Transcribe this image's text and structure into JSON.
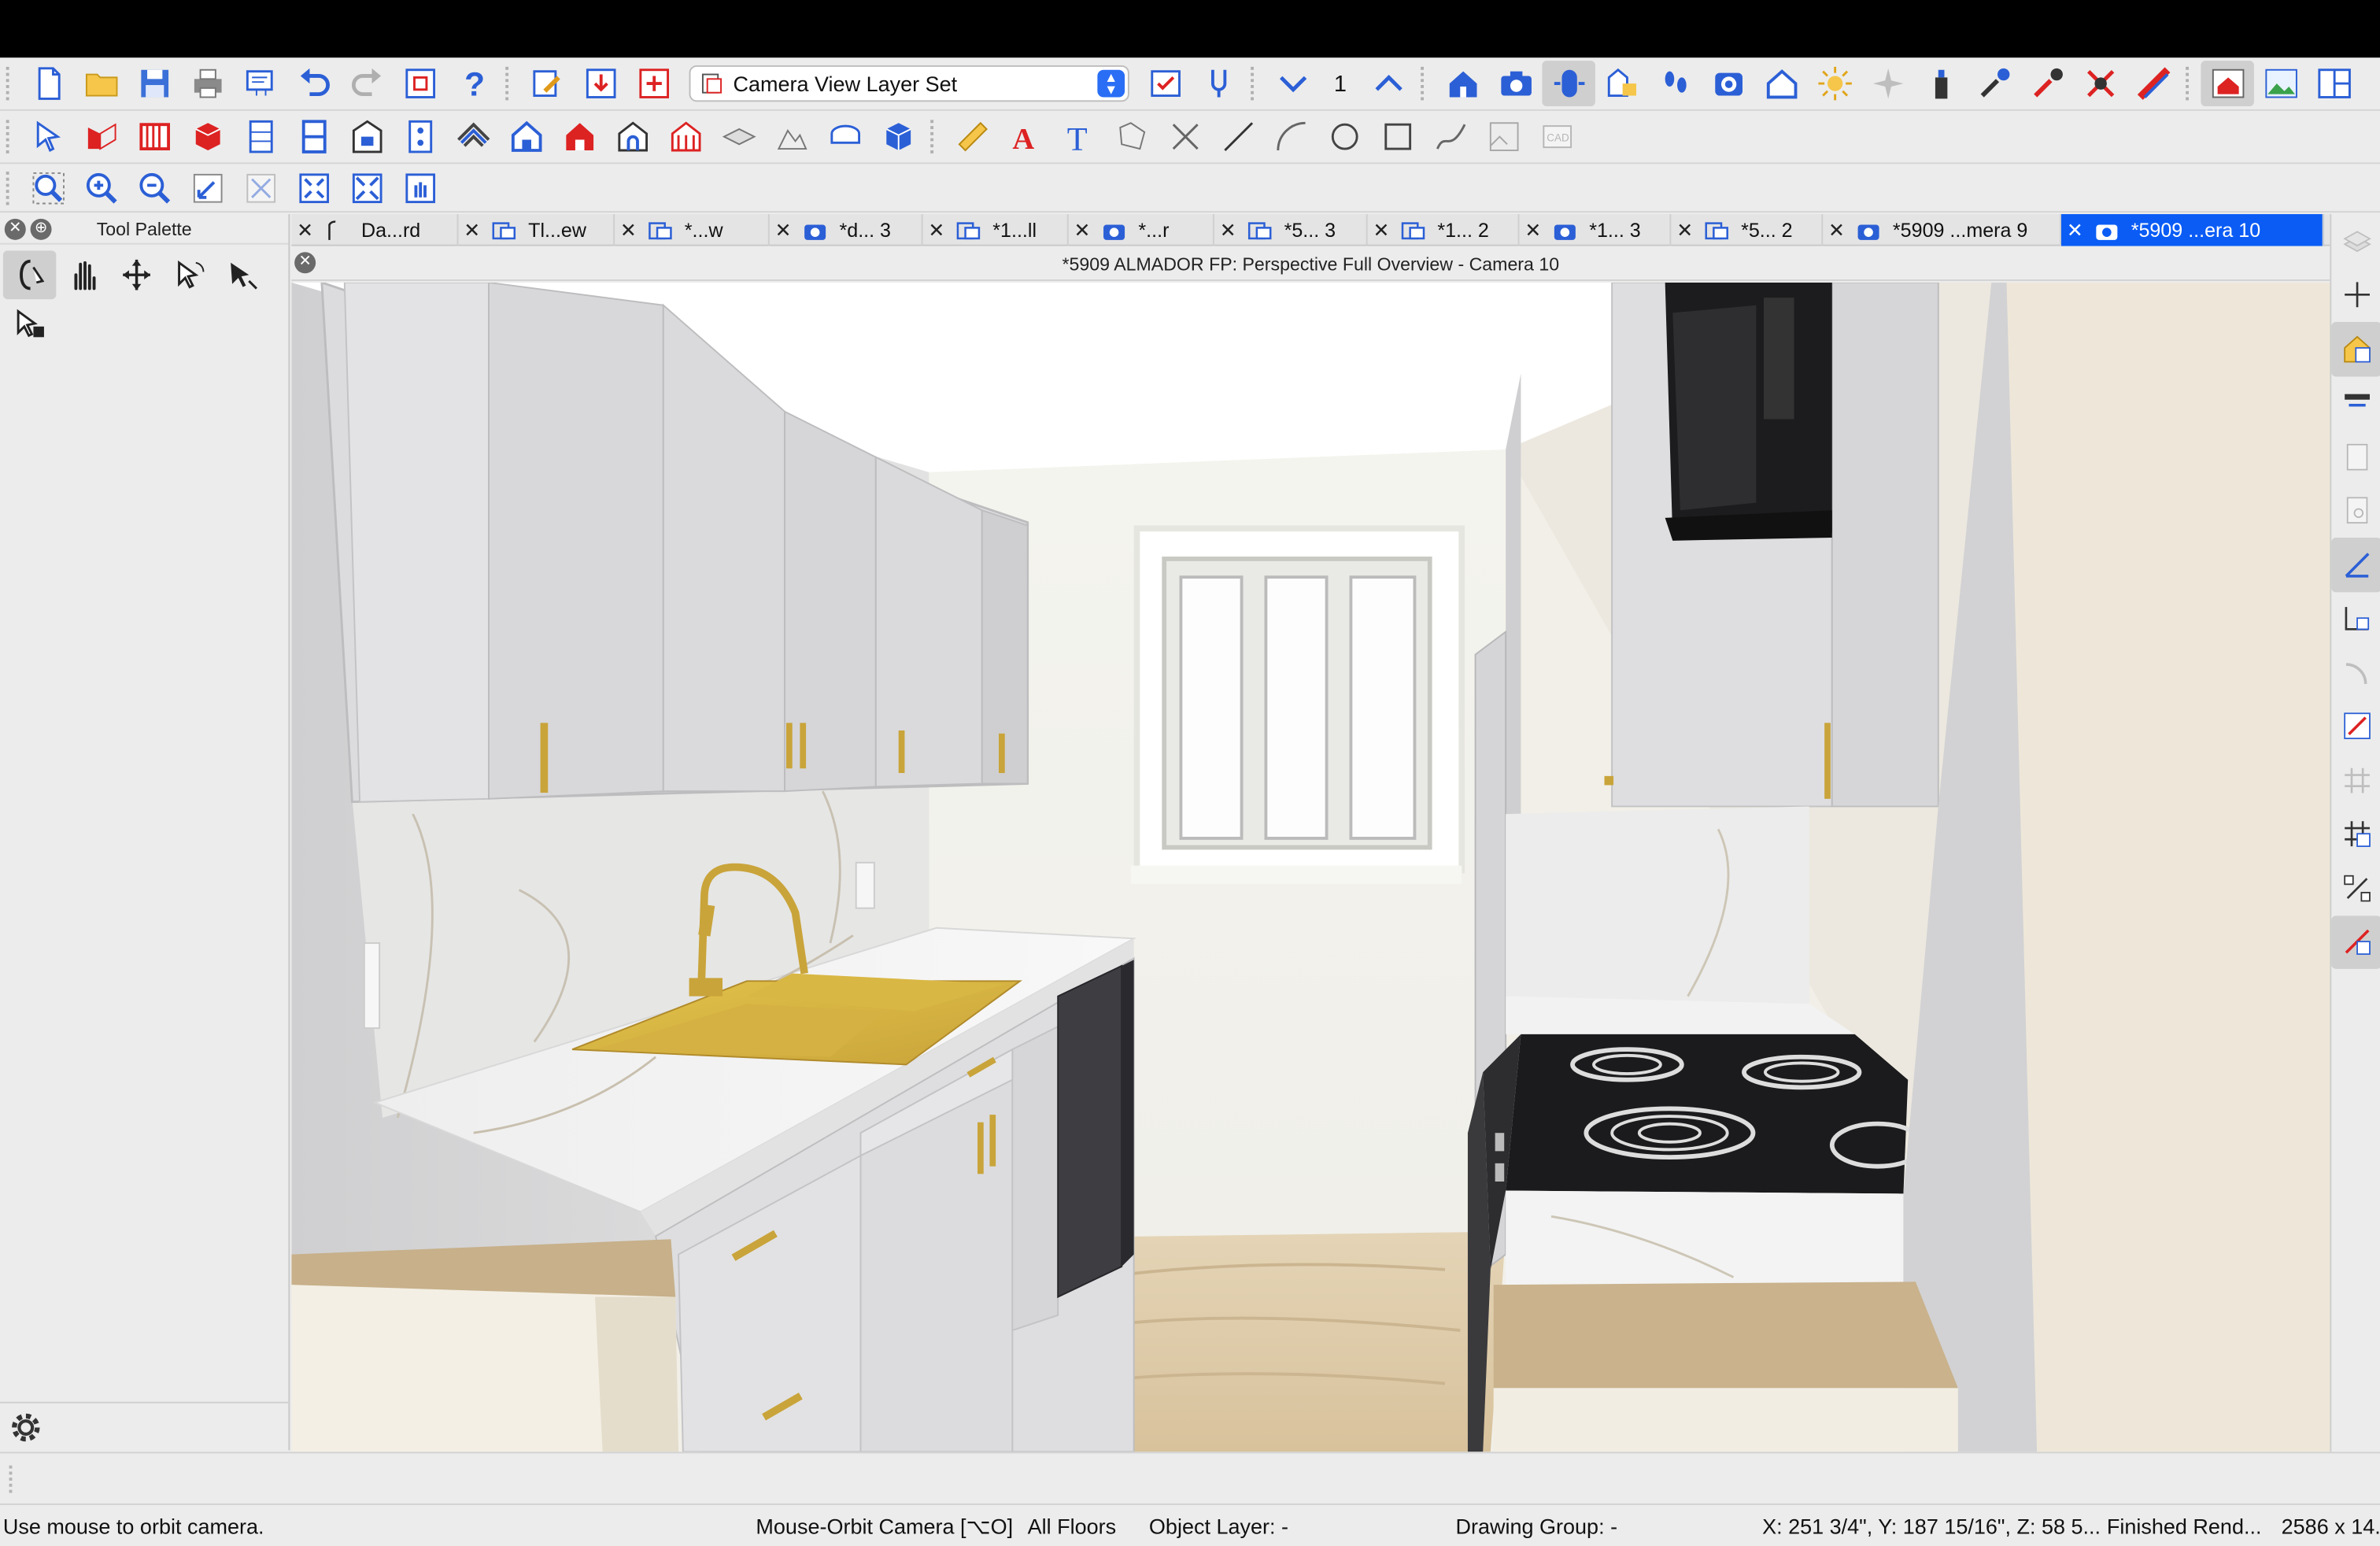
{
  "toolbar1": {
    "layer_set_label": "Camera View Layer Set",
    "floor_number": "1"
  },
  "tool_palette": {
    "title": "Tool Palette"
  },
  "tabs": [
    {
      "label": "Da...rd",
      "icon": "dimension-icon"
    },
    {
      "label": "Tl...ew",
      "icon": "plan-icon"
    },
    {
      "label": "*...w",
      "icon": "plan-icon"
    },
    {
      "label": "*d... 3",
      "icon": "camera-icon"
    },
    {
      "label": "*1...ll",
      "icon": "plan-icon"
    },
    {
      "label": "*...r",
      "icon": "camera-icon"
    },
    {
      "label": "*5... 3",
      "icon": "plan-icon"
    },
    {
      "label": "*1... 2",
      "icon": "plan-icon"
    },
    {
      "label": "*1... 3",
      "icon": "camera-icon"
    },
    {
      "label": "*5... 2",
      "icon": "plan-icon"
    },
    {
      "label": "*5909 ...mera 9",
      "icon": "camera-icon"
    },
    {
      "label": "*5909 ...era 10",
      "icon": "camera-icon"
    }
  ],
  "view": {
    "title": "*5909 ALMADOR FP: Perspective Full Overview - Camera 10"
  },
  "status_bar": {
    "hint": "Use mouse to orbit camera.",
    "mode": "Mouse-Orbit Camera [⌥O]",
    "floors": "All Floors",
    "object_layer": "Object Layer: -",
    "drawing_group": "Drawing Group: -",
    "coordinates": "X: 251 3/4\", Y: 187 15/16\", Z: 58 5...",
    "render_status": "Finished Rend...",
    "size": "2586 x 14..."
  },
  "colors": {
    "active_tab": "#0a5cf5",
    "accent_blue": "#2a6ef5",
    "cabinet": "#d7d7d9",
    "brass": "#c9a43a",
    "floor_wood": "#dcc8a6"
  }
}
